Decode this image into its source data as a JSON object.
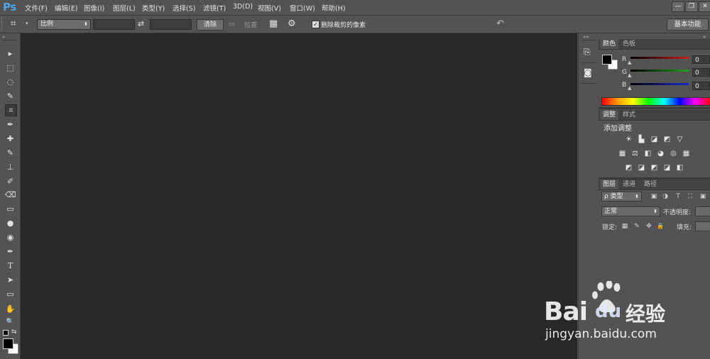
{
  "app": {
    "logo": "Ps"
  },
  "menu": [
    "文件(F)",
    "编辑(E)",
    "图像(I)",
    "图层(L)",
    "类型(Y)",
    "选择(S)",
    "滤镜(T)",
    "3D(D)",
    "视图(V)",
    "窗口(W)",
    "帮助(H)"
  ],
  "window_buttons": [
    "—",
    "❐",
    "✕"
  ],
  "options_bar": {
    "ratio_select": "比例",
    "swap_icon": "⇄",
    "clear_button": "清除",
    "straighten_label": "拉直",
    "delete_cropped_label": "删除裁剪的像素",
    "workspace_button": "基本功能"
  },
  "tools": [
    "▸",
    "⬚",
    "◌",
    "✎",
    "⌗",
    "✒",
    "✚",
    "✎",
    "⊥",
    "✐",
    "⌫",
    "▭",
    "●",
    "◉",
    "✒",
    "T",
    "➤",
    "▭",
    "✋",
    "🔍"
  ],
  "color_panel": {
    "tabs": [
      "颜色",
      "色板"
    ],
    "channels": [
      {
        "label": "R",
        "value": "0",
        "color": "#c81e1e"
      },
      {
        "label": "G",
        "value": "0",
        "color": "#1ea01e"
      },
      {
        "label": "B",
        "value": "0",
        "color": "#1e2ad0"
      }
    ],
    "foreground": "#000000",
    "background": "#ffffff"
  },
  "adjustments_panel": {
    "tabs": [
      "调整",
      "样式"
    ],
    "title": "添加调整",
    "row1": [
      "☀",
      "▙",
      "◪",
      "◩",
      "▽"
    ],
    "row2": [
      "▦",
      "⚖",
      "◧",
      "◕",
      "◎",
      "▦"
    ],
    "row3": [
      "◩",
      "◪",
      "◩",
      "◪",
      "◧"
    ]
  },
  "layers_panel": {
    "tabs": [
      "图层",
      "通道",
      "路径"
    ],
    "filter_label": "ρ 类型",
    "filter_icons": [
      "▣",
      "◑",
      "T",
      "⛶",
      "▣"
    ],
    "blend_mode": "正常",
    "opacity_label": "不透明度:",
    "lock_label": "锁定:",
    "lock_icons": [
      "▦",
      "✎",
      "✥",
      "🔒"
    ],
    "fill_label": "填充:"
  },
  "watermark": {
    "brand_text": "Bai",
    "brand_text2": "du",
    "brand_cn": "经验",
    "url": "jingyan.baidu.com"
  }
}
